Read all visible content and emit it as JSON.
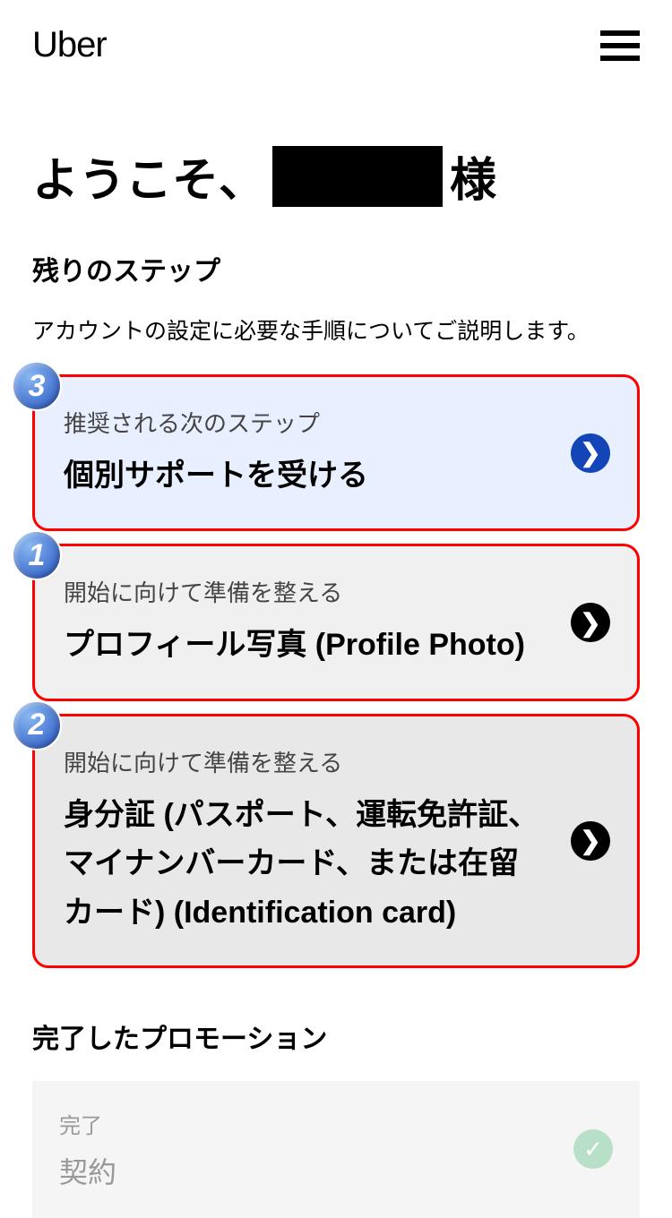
{
  "header": {
    "logo": "Uber"
  },
  "welcome": {
    "prefix": "ようこそ、",
    "suffix": "様"
  },
  "remaining_steps": {
    "title": "残りのステップ",
    "description": "アカウントの設定に必要な手順についてご説明します。"
  },
  "steps": [
    {
      "badge": "3",
      "label": "推奨される次のステップ",
      "title": "個別サポートを受ける"
    },
    {
      "badge": "1",
      "label": "開始に向けて準備を整える",
      "title": "プロフィール写真 (Profile Photo)"
    },
    {
      "badge": "2",
      "label": "開始に向けて準備を整える",
      "title": "身分証 (パスポート、運転免許証、マイナンバーカード、または在留カード) (Identification card)"
    }
  ],
  "completed": {
    "section_title": "完了したプロモーション",
    "label": "完了",
    "title": "契約"
  }
}
